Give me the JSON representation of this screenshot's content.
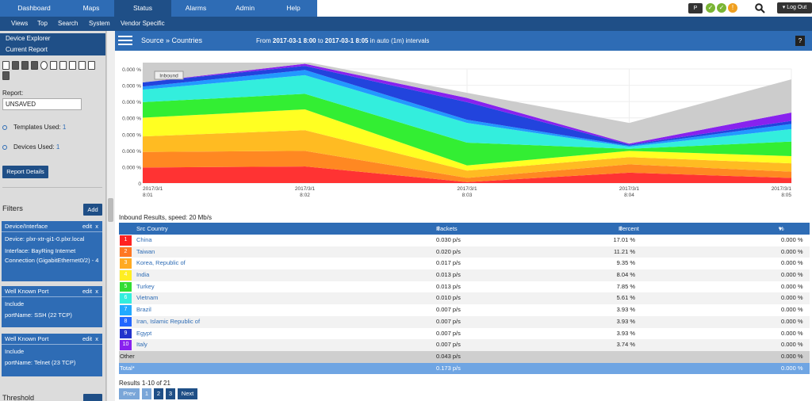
{
  "nav": {
    "tabs": [
      "Dashboard",
      "Maps",
      "Status",
      "Alarms",
      "Admin",
      "Help"
    ],
    "active": "Status",
    "logout": "Log Out"
  },
  "subnav": [
    "Views",
    "Top",
    "Search",
    "System",
    "Vendor Specific"
  ],
  "sidebar": {
    "links": [
      "Device Explorer",
      "Current Report"
    ],
    "report_label": "Report:",
    "report_value": "UNSAVED",
    "templates_label": "Templates Used:",
    "templates_count": "1",
    "devices_label": "Devices Used:",
    "devices_count": "1",
    "details_button": "Report Details",
    "filters_title": "Filters",
    "add_button": "Add",
    "threshold_label": "Threshold",
    "filters": [
      {
        "title": "Device/Interface",
        "edit": "edit",
        "remove": "x",
        "lines": [
          "Device: plxr-xtr-gi1-0.plxr.local",
          "Interface: BayRing Internet Connection (GigabitEthernet0/2) - 4"
        ]
      },
      {
        "title": "Well Known Port",
        "edit": "edit",
        "remove": "x",
        "lines": [
          "Include",
          "portName: SSH (22 TCP)"
        ]
      },
      {
        "title": "Well Known Port",
        "edit": "edit",
        "remove": "x",
        "lines": [
          "Include",
          "portName: Telnet (23 TCP)"
        ]
      }
    ]
  },
  "header": {
    "breadcrumb": "Source » Countries",
    "range_prefix": "From",
    "from": "2017-03-1 8:00",
    "to_word": "to",
    "to": "2017-03-1 8:05",
    "suffix": "in auto (1m) intervals",
    "help": "?"
  },
  "chart_data": {
    "type": "area",
    "legend_tag": "Inbound",
    "ytick_labels": [
      "0.000 %",
      "0.000 %",
      "0.000 %",
      "0.000 %",
      "0.000 %",
      "0.000 %",
      "0.000 %",
      "0"
    ],
    "x": [
      "2017/3/1 8:01",
      "2017/3/1 8:02",
      "2017/3/1 8:03",
      "2017/3/1 8:04",
      "2017/3/1 8:05"
    ],
    "x_lines": [
      [
        "2017/3/1",
        "8:01"
      ],
      [
        "2017/3/1",
        "8:02"
      ],
      [
        "2017/3/1",
        "8:03"
      ],
      [
        "2017/3/1",
        "8:04"
      ],
      [
        "2017/3/1",
        "8:05"
      ]
    ],
    "series": [
      {
        "color": "#ff3333",
        "values": [
          15,
          16,
          1,
          10,
          5
        ]
      },
      {
        "color": "#ff8822",
        "values": [
          15,
          15,
          4,
          8,
          6
        ]
      },
      {
        "color": "#ffbb22",
        "values": [
          15,
          20,
          7,
          7,
          8
        ]
      },
      {
        "color": "#ffff22",
        "values": [
          18,
          20,
          5,
          6,
          7
        ]
      },
      {
        "color": "#33ee33",
        "values": [
          15,
          15,
          22,
          2,
          14
        ]
      },
      {
        "color": "#33eedd",
        "values": [
          12,
          18,
          19,
          2,
          12
        ]
      },
      {
        "color": "#2299ff",
        "values": [
          3,
          5,
          3,
          1,
          5
        ]
      },
      {
        "color": "#2244dd",
        "values": [
          4,
          4,
          17,
          1,
          3
        ]
      },
      {
        "color": "#8822ee",
        "values": [
          0,
          2,
          4,
          1,
          8
        ]
      },
      {
        "color": "#cccccc",
        "values": [
          40,
          2,
          5,
          20,
          32
        ]
      }
    ]
  },
  "table": {
    "caption": "Inbound Results, speed: 20 Mb/s",
    "columns": [
      "Src Country",
      "Packets",
      "Percent",
      "% Util."
    ],
    "rows": [
      {
        "rank": "1",
        "country": "China",
        "packets": "0.030 p/s",
        "percent": "17.01 %",
        "util": "0.000 %",
        "color": "#ff2222"
      },
      {
        "rank": "2",
        "country": "Taiwan",
        "packets": "0.020 p/s",
        "percent": "11.21 %",
        "util": "0.000 %",
        "color": "#ff7722"
      },
      {
        "rank": "3",
        "country": "Korea, Republic of",
        "packets": "0.017 p/s",
        "percent": "9.35 %",
        "util": "0.000 %",
        "color": "#ffaa22"
      },
      {
        "rank": "4",
        "country": "India",
        "packets": "0.013 p/s",
        "percent": "8.04 %",
        "util": "0.000 %",
        "color": "#ffee22"
      },
      {
        "rank": "5",
        "country": "Turkey",
        "packets": "0.013 p/s",
        "percent": "7.85 %",
        "util": "0.000 %",
        "color": "#33dd33"
      },
      {
        "rank": "6",
        "country": "Vietnam",
        "packets": "0.010 p/s",
        "percent": "5.61 %",
        "util": "0.000 %",
        "color": "#33eedd"
      },
      {
        "rank": "7",
        "country": "Brazil",
        "packets": "0.007 p/s",
        "percent": "3.93 %",
        "util": "0.000 %",
        "color": "#22aaff"
      },
      {
        "rank": "8",
        "country": "Iran, Islamic Republic of",
        "packets": "0.007 p/s",
        "percent": "3.93 %",
        "util": "0.000 %",
        "color": "#2266ff"
      },
      {
        "rank": "9",
        "country": "Egypt",
        "packets": "0.007 p/s",
        "percent": "3.93 %",
        "util": "0.000 %",
        "color": "#2233cc"
      },
      {
        "rank": "10",
        "country": "Italy",
        "packets": "0.007 p/s",
        "percent": "3.74 %",
        "util": "0.000 %",
        "color": "#8822ee"
      }
    ],
    "other": {
      "label": "Other",
      "packets": "0.043 p/s",
      "util": "0.000 %"
    },
    "total": {
      "label": "Total*",
      "packets": "0.173 p/s",
      "util": "0.000 %"
    }
  },
  "pagination": {
    "summary": "Results 1-10 of 21",
    "prev": "Prev",
    "pages": [
      "1",
      "2",
      "3"
    ],
    "next": "Next"
  }
}
